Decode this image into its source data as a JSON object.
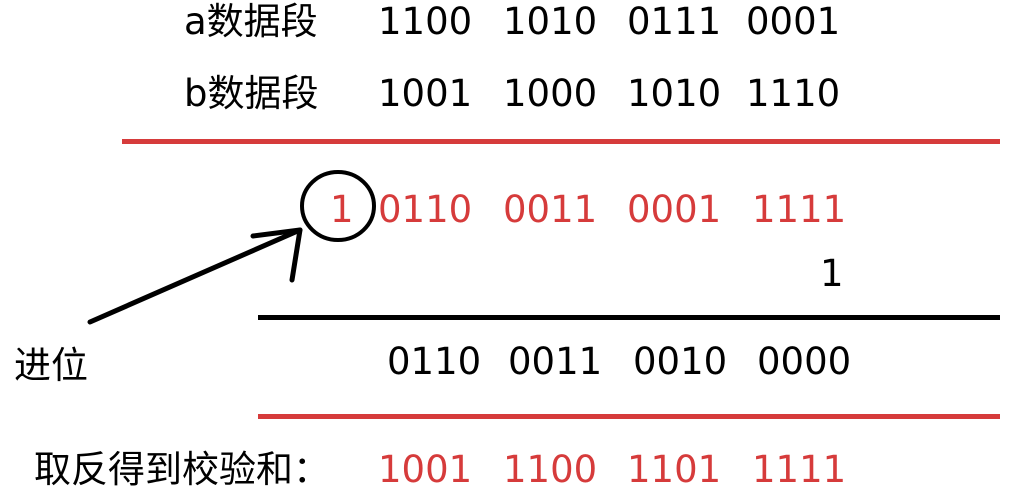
{
  "colors": {
    "red": "#d63b3b",
    "black": "#000000"
  },
  "row_a": {
    "label": "a数据段",
    "bits": [
      "1100",
      "1010",
      "0111",
      "0001"
    ]
  },
  "row_b": {
    "label": "b数据段",
    "bits": [
      "1001",
      "1000",
      "1010",
      "1110"
    ]
  },
  "sum_row": {
    "carry": "1",
    "bits": [
      "0110",
      "0011",
      "0001",
      "1111"
    ]
  },
  "carry_add": "1",
  "carry_label": "进位",
  "result_row": {
    "bits": [
      "0110",
      "0011",
      "0010",
      "0000"
    ]
  },
  "checksum_row": {
    "label": "取反得到校验和：",
    "bits": [
      "1001",
      "1100",
      "1101",
      "1111"
    ]
  }
}
